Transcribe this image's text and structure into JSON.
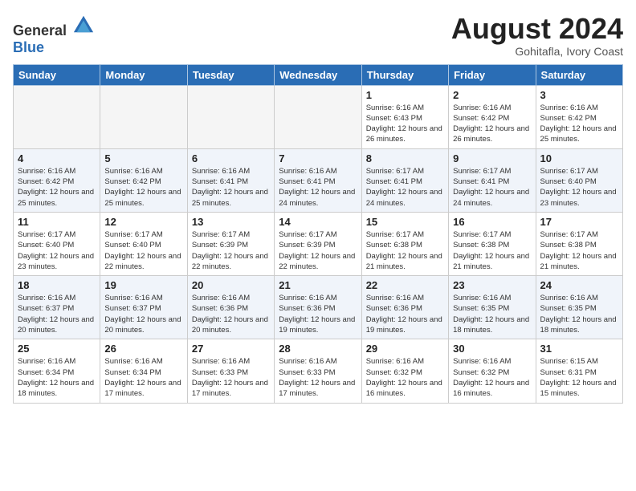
{
  "header": {
    "logo_general": "General",
    "logo_blue": "Blue",
    "month_year": "August 2024",
    "location": "Gohitafla, Ivory Coast"
  },
  "weekdays": [
    "Sunday",
    "Monday",
    "Tuesday",
    "Wednesday",
    "Thursday",
    "Friday",
    "Saturday"
  ],
  "weeks": [
    [
      {
        "day": "",
        "empty": true
      },
      {
        "day": "",
        "empty": true
      },
      {
        "day": "",
        "empty": true
      },
      {
        "day": "",
        "empty": true
      },
      {
        "day": "1",
        "sunrise": "6:16 AM",
        "sunset": "6:43 PM",
        "daylight": "12 hours and 26 minutes."
      },
      {
        "day": "2",
        "sunrise": "6:16 AM",
        "sunset": "6:42 PM",
        "daylight": "12 hours and 26 minutes."
      },
      {
        "day": "3",
        "sunrise": "6:16 AM",
        "sunset": "6:42 PM",
        "daylight": "12 hours and 25 minutes."
      }
    ],
    [
      {
        "day": "4",
        "sunrise": "6:16 AM",
        "sunset": "6:42 PM",
        "daylight": "12 hours and 25 minutes."
      },
      {
        "day": "5",
        "sunrise": "6:16 AM",
        "sunset": "6:42 PM",
        "daylight": "12 hours and 25 minutes."
      },
      {
        "day": "6",
        "sunrise": "6:16 AM",
        "sunset": "6:41 PM",
        "daylight": "12 hours and 25 minutes."
      },
      {
        "day": "7",
        "sunrise": "6:16 AM",
        "sunset": "6:41 PM",
        "daylight": "12 hours and 24 minutes."
      },
      {
        "day": "8",
        "sunrise": "6:17 AM",
        "sunset": "6:41 PM",
        "daylight": "12 hours and 24 minutes."
      },
      {
        "day": "9",
        "sunrise": "6:17 AM",
        "sunset": "6:41 PM",
        "daylight": "12 hours and 24 minutes."
      },
      {
        "day": "10",
        "sunrise": "6:17 AM",
        "sunset": "6:40 PM",
        "daylight": "12 hours and 23 minutes."
      }
    ],
    [
      {
        "day": "11",
        "sunrise": "6:17 AM",
        "sunset": "6:40 PM",
        "daylight": "12 hours and 23 minutes."
      },
      {
        "day": "12",
        "sunrise": "6:17 AM",
        "sunset": "6:40 PM",
        "daylight": "12 hours and 22 minutes."
      },
      {
        "day": "13",
        "sunrise": "6:17 AM",
        "sunset": "6:39 PM",
        "daylight": "12 hours and 22 minutes."
      },
      {
        "day": "14",
        "sunrise": "6:17 AM",
        "sunset": "6:39 PM",
        "daylight": "12 hours and 22 minutes."
      },
      {
        "day": "15",
        "sunrise": "6:17 AM",
        "sunset": "6:38 PM",
        "daylight": "12 hours and 21 minutes."
      },
      {
        "day": "16",
        "sunrise": "6:17 AM",
        "sunset": "6:38 PM",
        "daylight": "12 hours and 21 minutes."
      },
      {
        "day": "17",
        "sunrise": "6:17 AM",
        "sunset": "6:38 PM",
        "daylight": "12 hours and 21 minutes."
      }
    ],
    [
      {
        "day": "18",
        "sunrise": "6:16 AM",
        "sunset": "6:37 PM",
        "daylight": "12 hours and 20 minutes."
      },
      {
        "day": "19",
        "sunrise": "6:16 AM",
        "sunset": "6:37 PM",
        "daylight": "12 hours and 20 minutes."
      },
      {
        "day": "20",
        "sunrise": "6:16 AM",
        "sunset": "6:36 PM",
        "daylight": "12 hours and 20 minutes."
      },
      {
        "day": "21",
        "sunrise": "6:16 AM",
        "sunset": "6:36 PM",
        "daylight": "12 hours and 19 minutes."
      },
      {
        "day": "22",
        "sunrise": "6:16 AM",
        "sunset": "6:36 PM",
        "daylight": "12 hours and 19 minutes."
      },
      {
        "day": "23",
        "sunrise": "6:16 AM",
        "sunset": "6:35 PM",
        "daylight": "12 hours and 18 minutes."
      },
      {
        "day": "24",
        "sunrise": "6:16 AM",
        "sunset": "6:35 PM",
        "daylight": "12 hours and 18 minutes."
      }
    ],
    [
      {
        "day": "25",
        "sunrise": "6:16 AM",
        "sunset": "6:34 PM",
        "daylight": "12 hours and 18 minutes."
      },
      {
        "day": "26",
        "sunrise": "6:16 AM",
        "sunset": "6:34 PM",
        "daylight": "12 hours and 17 minutes."
      },
      {
        "day": "27",
        "sunrise": "6:16 AM",
        "sunset": "6:33 PM",
        "daylight": "12 hours and 17 minutes."
      },
      {
        "day": "28",
        "sunrise": "6:16 AM",
        "sunset": "6:33 PM",
        "daylight": "12 hours and 17 minutes."
      },
      {
        "day": "29",
        "sunrise": "6:16 AM",
        "sunset": "6:32 PM",
        "daylight": "12 hours and 16 minutes."
      },
      {
        "day": "30",
        "sunrise": "6:16 AM",
        "sunset": "6:32 PM",
        "daylight": "12 hours and 16 minutes."
      },
      {
        "day": "31",
        "sunrise": "6:15 AM",
        "sunset": "6:31 PM",
        "daylight": "12 hours and 15 minutes."
      }
    ]
  ]
}
